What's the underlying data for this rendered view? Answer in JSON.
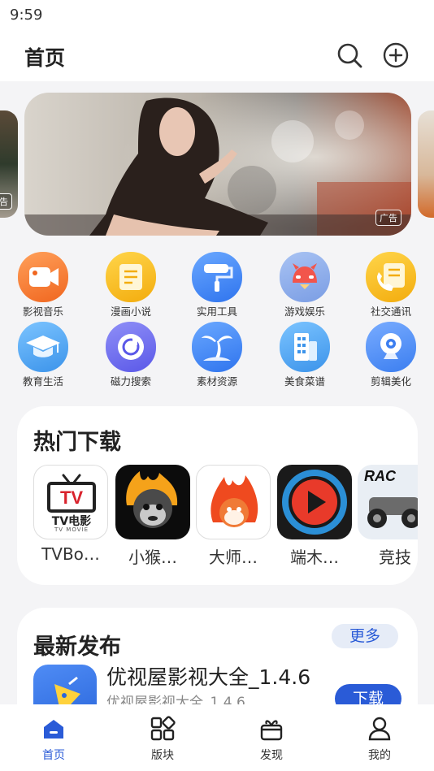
{
  "status_bar": {
    "time": "9:59"
  },
  "header": {
    "title": "首页",
    "search_icon": "search-icon",
    "add_icon": "plus-circle-icon"
  },
  "banner": {
    "ad_label": "广告",
    "left_ad_label": "告"
  },
  "categories": [
    {
      "label": "影视音乐",
      "icon": "video-camera-icon",
      "color": "#f7772b"
    },
    {
      "label": "漫画小说",
      "icon": "document-icon",
      "color": "#f5b816"
    },
    {
      "label": "实用工具",
      "icon": "paint-roller-icon",
      "color": "#3d8af7"
    },
    {
      "label": "游戏娱乐",
      "icon": "game-character-icon",
      "color": "#8fb0ea"
    },
    {
      "label": "社交通讯",
      "icon": "phone-note-icon",
      "color": "#f5b816"
    },
    {
      "label": "教育生活",
      "icon": "graduation-cap-icon",
      "color": "#4aa7f2"
    },
    {
      "label": "磁力搜索",
      "icon": "magnet-search-icon",
      "color": "#6d6ef0"
    },
    {
      "label": "素材资源",
      "icon": "palm-tree-icon",
      "color": "#3d8af7"
    },
    {
      "label": "美食菜谱",
      "icon": "building-icon",
      "color": "#4aa7f2"
    },
    {
      "label": "剪辑美化",
      "icon": "webcam-icon",
      "color": "#4c8ff5"
    }
  ],
  "hot_downloads": {
    "title": "热门下载",
    "apps": [
      {
        "name": "TVBo…",
        "icon_text": "TV",
        "icon_sub": "TV电影",
        "icon_caption": "TV MOVIE"
      },
      {
        "name": "小猴…"
      },
      {
        "name": "大师…"
      },
      {
        "name": "端木…"
      },
      {
        "name": "竞技",
        "icon_text": "RAC"
      }
    ]
  },
  "latest": {
    "title": "最新发布",
    "more_label": "更多",
    "item": {
      "name": "优视屋影视大全_1.4.6",
      "subtitle": "优视屋影视大全_1.4.6",
      "download_label": "下载"
    }
  },
  "bottom_nav": [
    {
      "label": "首页",
      "icon": "home-icon",
      "active": true
    },
    {
      "label": "版块",
      "icon": "grid-blocks-icon",
      "active": false
    },
    {
      "label": "发现",
      "icon": "gift-box-icon",
      "active": false
    },
    {
      "label": "我的",
      "icon": "user-icon",
      "active": false
    }
  ],
  "colors": {
    "accent": "#2a5bd7",
    "background": "#f4f4f6",
    "card": "#ffffff"
  }
}
